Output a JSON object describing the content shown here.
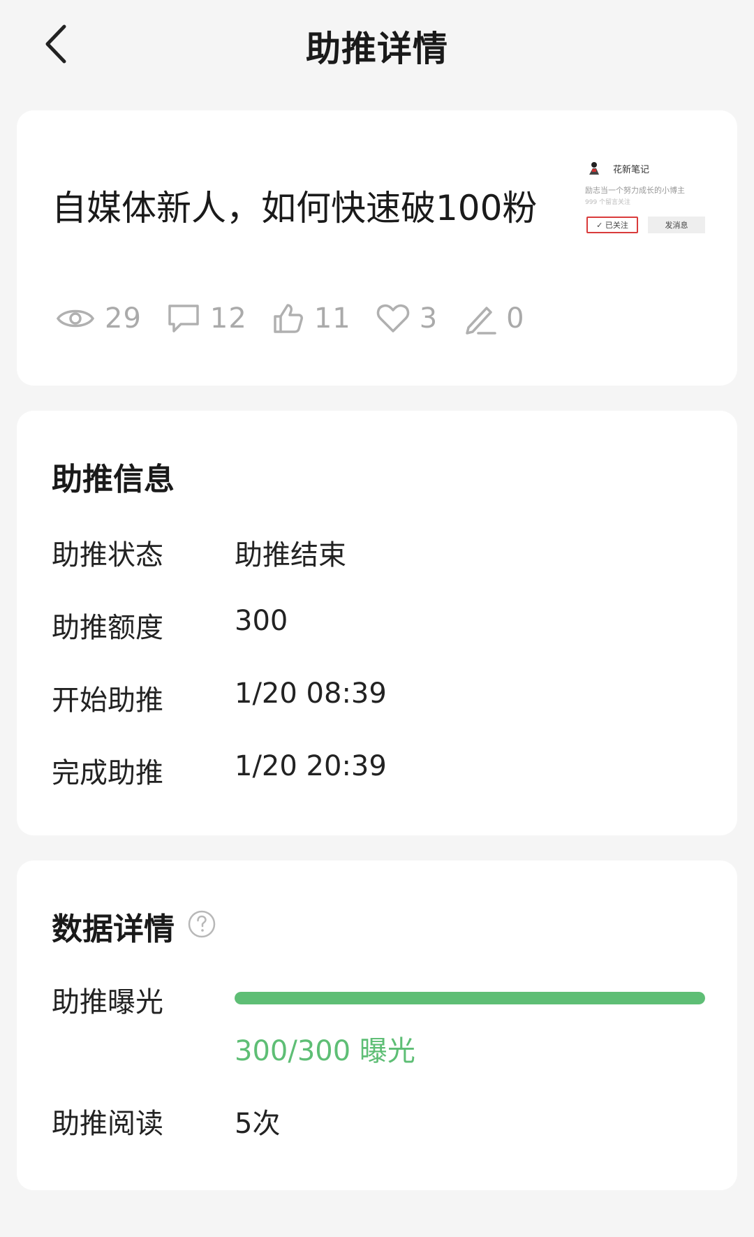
{
  "header": {
    "title": "助推详情",
    "back_icon": "chevron-left-icon"
  },
  "article": {
    "title": "自媒体新人，如何快速破100粉",
    "thumbnail": {
      "name": "花新笔记",
      "desc": "励志当一个努力成长的小博主",
      "sub": "999 个留言关注",
      "follow_label": "✓ 已关注",
      "message_label": "发消息"
    },
    "stats": [
      {
        "icon": "eye-icon",
        "value": "29"
      },
      {
        "icon": "comment-icon",
        "value": "12"
      },
      {
        "icon": "thumbs-up-icon",
        "value": "11"
      },
      {
        "icon": "heart-icon",
        "value": "3"
      },
      {
        "icon": "pen-icon",
        "value": "0"
      }
    ]
  },
  "info": {
    "title": "助推信息",
    "rows": [
      {
        "label": "助推状态",
        "value": "助推结束"
      },
      {
        "label": "助推额度",
        "value": "300"
      },
      {
        "label": "开始助推",
        "value": "1/20 08:39"
      },
      {
        "label": "完成助推",
        "value": "1/20 20:39"
      }
    ]
  },
  "data_details": {
    "title": "数据详情",
    "help_icon": "question-circle-icon",
    "exposure": {
      "label": "助推曝光",
      "progress_text": "300/300 曝光",
      "progress_fraction": 1.0
    },
    "reads": {
      "label": "助推阅读",
      "value": "5次"
    }
  },
  "colors": {
    "accent_green": "#5ebe75",
    "background": "#f5f5f5",
    "card": "#ffffff",
    "muted": "#aaaaaa"
  }
}
